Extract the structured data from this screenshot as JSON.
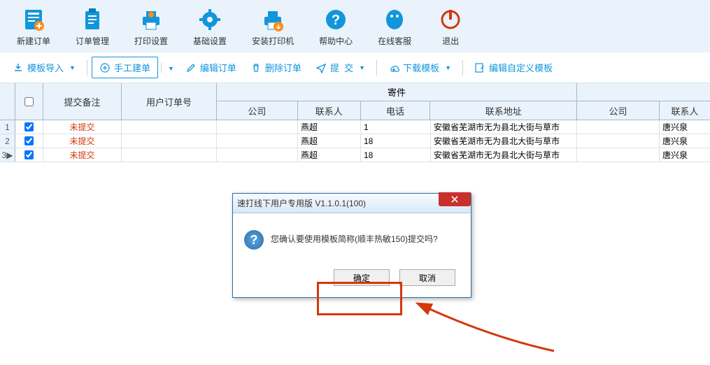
{
  "toolbar": {
    "new_order": "新建订单",
    "order_mgmt": "订单管理",
    "print_settings": "打印设置",
    "basic_settings": "基础设置",
    "install_printer": "安装打印机",
    "help": "帮助中心",
    "online_service": "在线客服",
    "exit": "退出"
  },
  "subtoolbar": {
    "import_template": "模板导入",
    "manual_create": "手工建单",
    "edit_order": "编辑订单",
    "delete_order": "删除订单",
    "submit": "提  交",
    "download_template": "下载模板",
    "edit_custom_template": "编辑自定义模板"
  },
  "headers": {
    "submit_note": "提交备注",
    "user_order_no": "用户订单号",
    "sender_group": "寄件",
    "company": "公司",
    "contact": "联系人",
    "phone": "电话",
    "address": "联系地址",
    "recv_company": "公司",
    "recv_contact": "联系人"
  },
  "rows": [
    {
      "idx": "1",
      "checked": true,
      "note": "未提交",
      "uorder": "",
      "company": "",
      "contact": "燕超",
      "phone": "1",
      "addr": "安徽省芜湖市无为县北大街与草市",
      "rcompany": "",
      "rcontact": "唐兴泉"
    },
    {
      "idx": "2",
      "checked": true,
      "note": "未提交",
      "uorder": "",
      "company": "",
      "contact": "燕超",
      "phone": "18",
      "addr": "安徽省芜湖市无为县北大街与草市",
      "rcompany": "",
      "rcontact": "唐兴泉"
    },
    {
      "idx": "3▶",
      "checked": true,
      "note": "未提交",
      "uorder": "",
      "company": "",
      "contact": "燕超",
      "phone": "18",
      "addr": "安徽省芜湖市无为县北大街与草市",
      "rcompany": "",
      "rcontact": "唐兴泉"
    }
  ],
  "dialog": {
    "title": "速打线下用户专用版 V1.1.0.1(100)",
    "message": "您确认要使用模板简称(顺丰热敏150)提交吗?",
    "ok": "确定",
    "cancel": "取消"
  }
}
